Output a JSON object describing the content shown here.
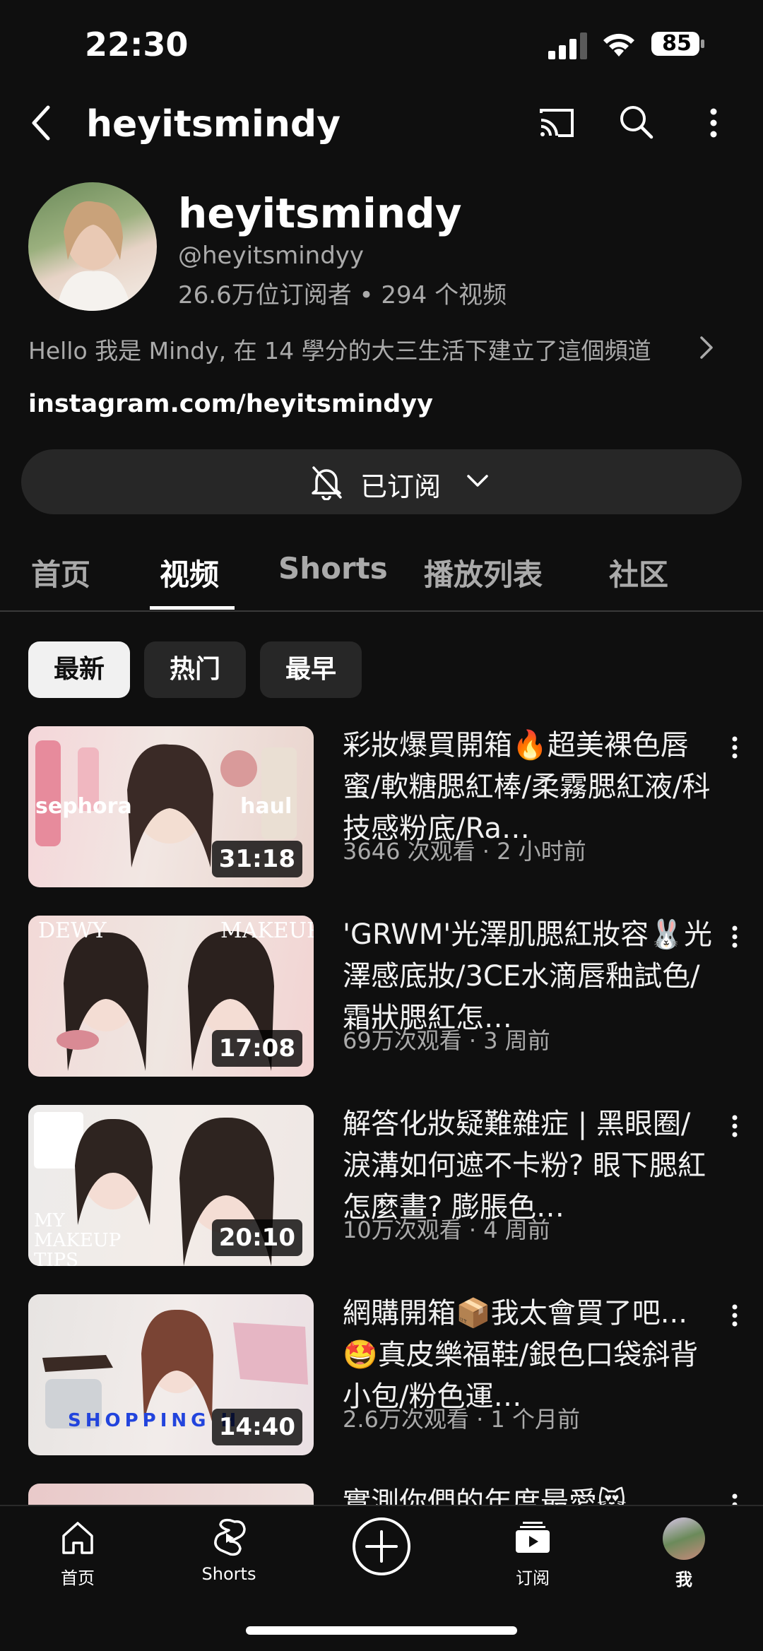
{
  "status_bar": {
    "time": "22:30",
    "battery": "85"
  },
  "app_bar": {
    "title": "heyitsmindy"
  },
  "channel": {
    "name": "heyitsmindy",
    "handle": "@heyitsmindyy",
    "stats": "26.6万位订阅者 • 294 个视频",
    "description": "Hello 我是 Mindy, 在 14 學分的大三生活下建立了這個頻道",
    "link": "instagram.com/heyitsmindyy",
    "subscribe_label": "已订阅"
  },
  "tabs": [
    {
      "label": "首页"
    },
    {
      "label": "视频"
    },
    {
      "label": "Shorts"
    },
    {
      "label": "播放列表"
    },
    {
      "label": "社区"
    }
  ],
  "active_tab": "视频",
  "chips": [
    {
      "label": "最新"
    },
    {
      "label": "热门"
    },
    {
      "label": "最早"
    }
  ],
  "videos": [
    {
      "title": "彩妝爆買開箱🔥超美裸色唇蜜/軟糖腮紅棒/柔霧腮紅液/科技感粉底/Ra…",
      "meta": "3646 次观看 · 2 小时前",
      "duration": "31:18",
      "thumb_text_left": "sephora",
      "thumb_text_right": "haul"
    },
    {
      "title": "'GRWM'光澤肌腮紅妝容🐰光澤感底妝/3CE水滴唇釉試色/霜狀腮紅怎…",
      "meta": "69万次观看 · 3 周前",
      "duration": "17:08",
      "thumb_text_left": "DEWY",
      "thumb_text_right": "MAKEUP"
    },
    {
      "title": "解答化妝疑難雜症 | 黑眼圈/淚溝如何遮不卡粉? 眼下腮紅怎麼畫? 膨脹色…",
      "meta": "10万次观看 · 4 周前",
      "duration": "20:10",
      "thumb_text_left": "MY MAKEUP TIPS",
      "thumb_text_right": ""
    },
    {
      "title": "網購開箱📦我太會買了吧...🤩真皮樂福鞋/銀色口袋斜背小包/粉色運…",
      "meta": "2.6万次观看 · 1 个月前",
      "duration": "14:40",
      "thumb_text_left": "SHOPPING H",
      "thumb_text_right": ""
    },
    {
      "title": "實測你們的年度最愛😻",
      "meta": "",
      "duration": "",
      "thumb_text_left": "",
      "thumb_text_right": ""
    }
  ],
  "bottom_nav": [
    {
      "label": "首页",
      "icon": "home-icon"
    },
    {
      "label": "Shorts",
      "icon": "shorts-icon"
    },
    {
      "label": "",
      "icon": "create-icon"
    },
    {
      "label": "订阅",
      "icon": "subscriptions-icon"
    },
    {
      "label": "我",
      "icon": "avatar"
    }
  ]
}
